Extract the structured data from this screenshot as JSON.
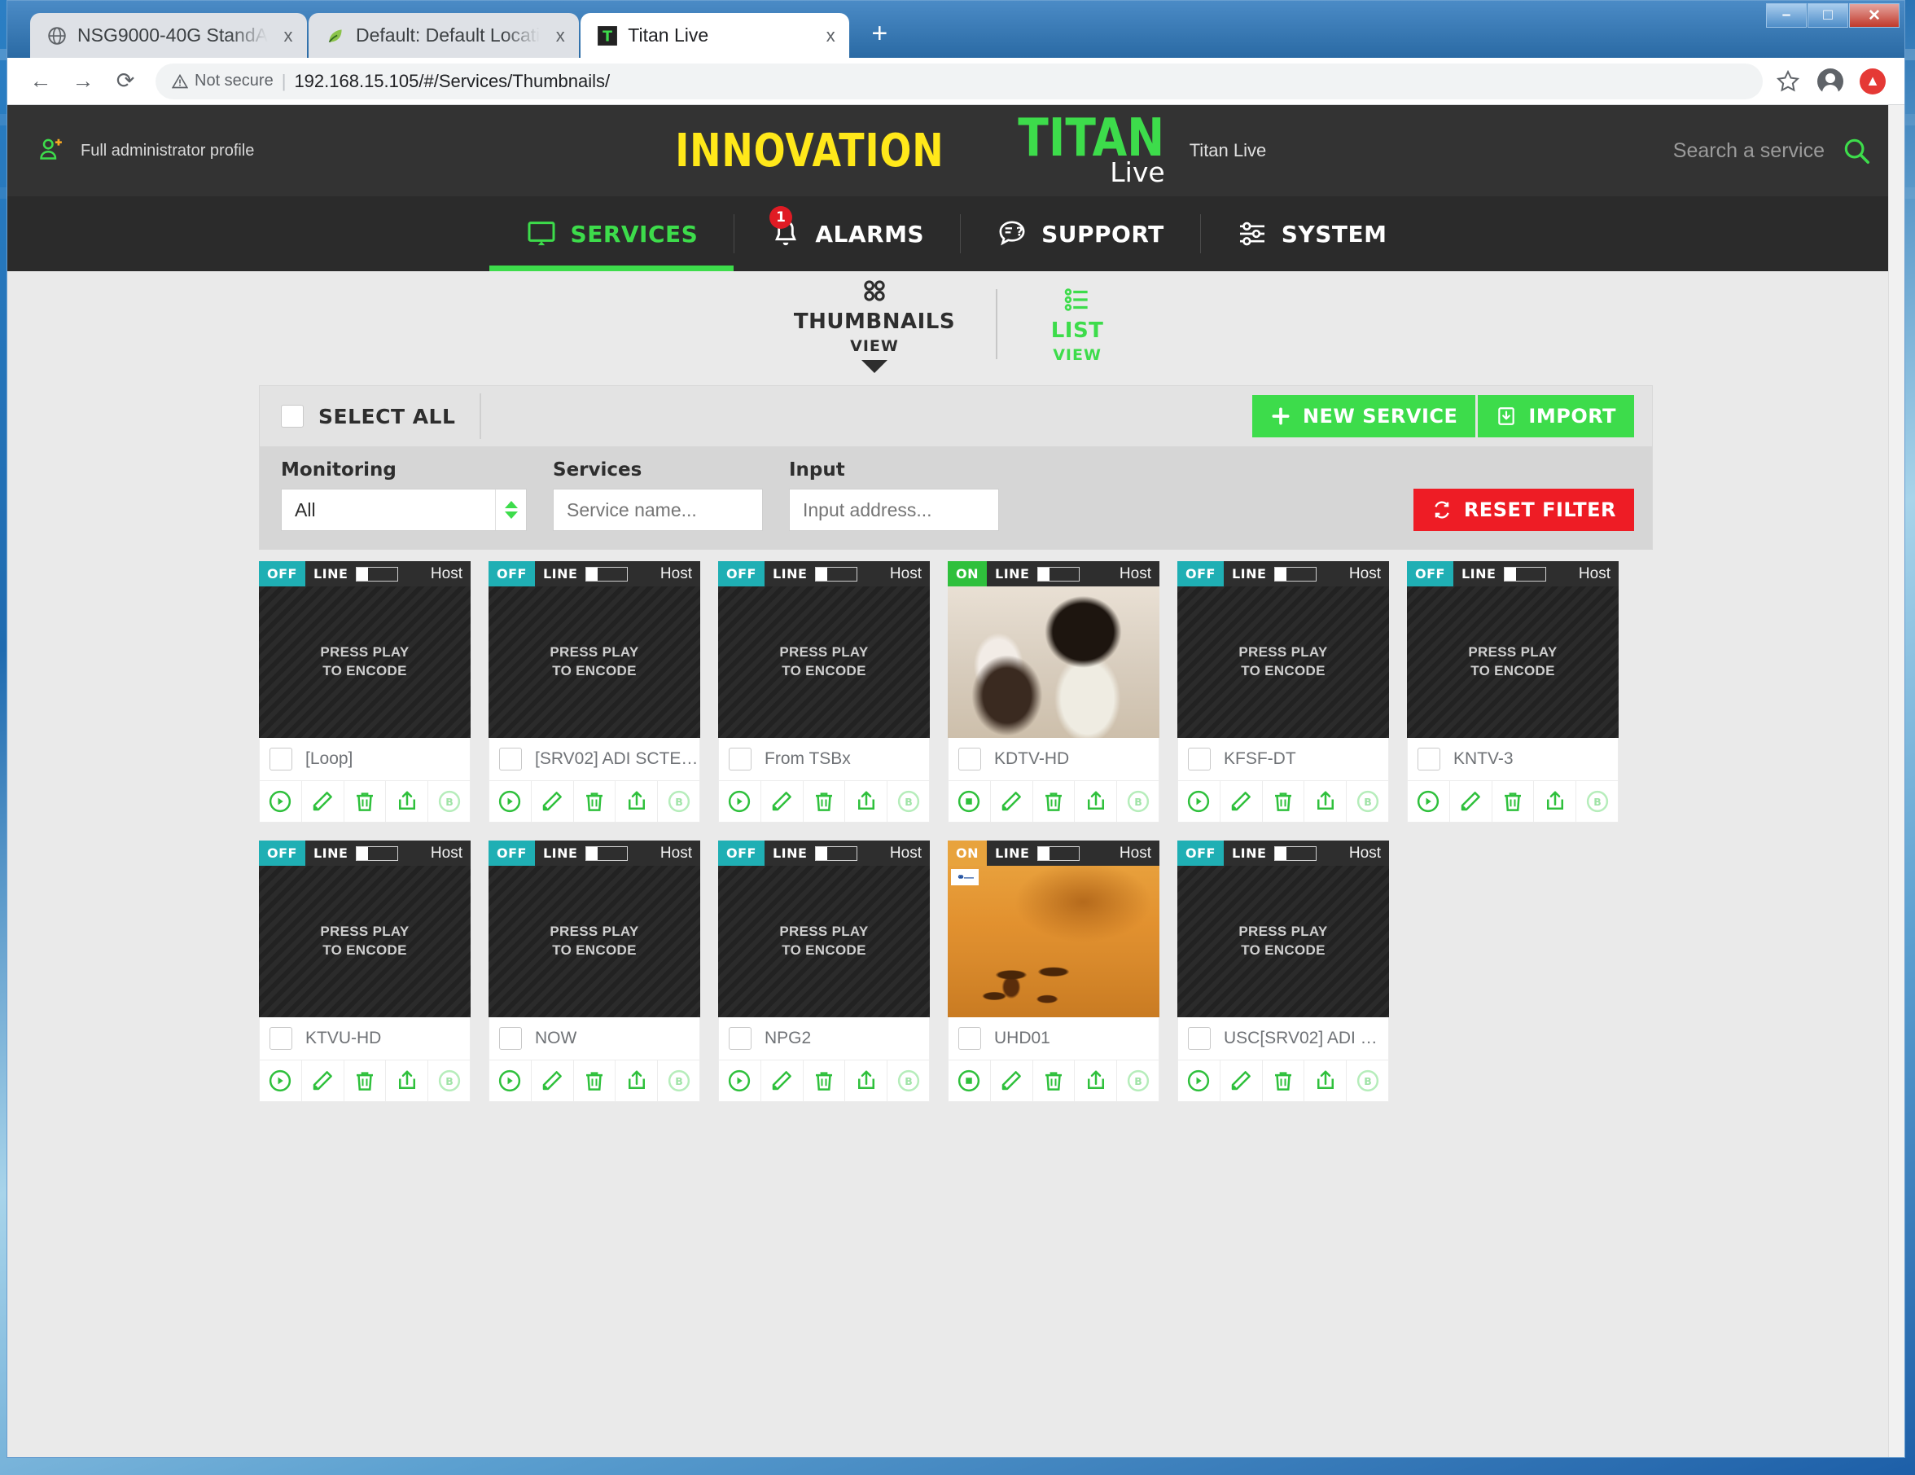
{
  "browser": {
    "tabs": [
      {
        "title": "NSG9000-40G StandA",
        "favicon": "globe-icon",
        "active": false
      },
      {
        "title": "Default: Default Locati",
        "favicon": "leaf-icon",
        "active": false
      },
      {
        "title": "Titan Live",
        "favicon": "titan-icon",
        "active": true
      }
    ],
    "new_tab_label": "+",
    "close_label": "x",
    "nav": {
      "back": "←",
      "forward": "→",
      "reload": "⟳"
    },
    "security_label": "Not secure",
    "separator": "|",
    "url": "192.168.15.105/#/Services/Thumbnails/",
    "window_controls": {
      "minimize": "–",
      "maximize": "□",
      "close": "✕"
    }
  },
  "header": {
    "profile_label": "Full administrator profile",
    "profile_icon": "user-add-icon",
    "brand_innovation": "INNOVATION",
    "brand_titan": "TITAN",
    "brand_live": "Live",
    "product_name": "Titan Live",
    "search_placeholder": "Search a service",
    "search_icon": "search-icon",
    "colors": {
      "yellow": "#ffe81a",
      "green": "#3ddc4b",
      "bar": "#333333"
    }
  },
  "nav": {
    "items": [
      {
        "label": "SERVICES",
        "icon": "monitor-icon",
        "active": true,
        "badge": null
      },
      {
        "label": "ALARMS",
        "icon": "bell-icon",
        "active": false,
        "badge": "1"
      },
      {
        "label": "SUPPORT",
        "icon": "help-bubble-icon",
        "active": false,
        "badge": null
      },
      {
        "label": "SYSTEM",
        "icon": "sliders-icon",
        "active": false,
        "badge": null
      }
    ]
  },
  "view_switcher": {
    "options": [
      {
        "name": "THUMBNAILS",
        "sub": "VIEW",
        "icon": "grid-dots-icon",
        "active": true
      },
      {
        "name": "LIST",
        "sub": "VIEW",
        "icon": "list-icon",
        "active": false
      }
    ]
  },
  "toolbar": {
    "select_all_label": "SELECT ALL",
    "new_service_label": "NEW SERVICE",
    "new_service_icon": "plus-icon",
    "import_label": "IMPORT",
    "import_icon": "import-icon",
    "reset_filter_label": "RESET FILTER",
    "reset_filter_icon": "refresh-icon"
  },
  "filters": {
    "monitoring_label": "Monitoring",
    "monitoring_value": "All",
    "services_label": "Services",
    "services_placeholder": "Service name...",
    "input_label": "Input",
    "input_placeholder": "Input address..."
  },
  "thumbnail_placeholder": "PRESS PLAY\nTO ENCODE",
  "thumbnail_placeholder_line1": "PRESS PLAY",
  "thumbnail_placeholder_line2": "TO ENCODE",
  "card_labels": {
    "line": "LINE",
    "host": "Host",
    "status_off": "OFF",
    "status_on": "ON",
    "biss_label": "B"
  },
  "services": [
    {
      "name": "[Loop]",
      "status": "OFF",
      "status_color": "#1fafb4",
      "line": "LINE",
      "host": "Host",
      "thumb": "placeholder",
      "play_state": "play",
      "key_badge": false
    },
    {
      "name": "[SRV02] ADI SCTE…",
      "status": "OFF",
      "status_color": "#1fafb4",
      "line": "LINE",
      "host": "Host",
      "thumb": "placeholder",
      "play_state": "play",
      "key_badge": false
    },
    {
      "name": "From TSBx",
      "status": "OFF",
      "status_color": "#1fafb4",
      "line": "LINE",
      "host": "Host",
      "thumb": "placeholder",
      "play_state": "play",
      "key_badge": false
    },
    {
      "name": "KDTV-HD",
      "status": "ON",
      "status_color": "#2fc03c",
      "line": "LINE",
      "host": "Host",
      "thumb": "live-people",
      "play_state": "stop",
      "key_badge": false
    },
    {
      "name": "KFSF-DT",
      "status": "OFF",
      "status_color": "#1fafb4",
      "line": "LINE",
      "host": "Host",
      "thumb": "placeholder",
      "play_state": "play",
      "key_badge": false
    },
    {
      "name": "KNTV-3",
      "status": "OFF",
      "status_color": "#1fafb4",
      "line": "LINE",
      "host": "Host",
      "thumb": "placeholder",
      "play_state": "play",
      "key_badge": false
    },
    {
      "name": "KTVU-HD",
      "status": "OFF",
      "status_color": "#1fafb4",
      "line": "LINE",
      "host": "Host",
      "thumb": "placeholder",
      "play_state": "play",
      "key_badge": false
    },
    {
      "name": "NOW",
      "status": "OFF",
      "status_color": "#1fafb4",
      "line": "LINE",
      "host": "Host",
      "thumb": "placeholder",
      "play_state": "play",
      "key_badge": false
    },
    {
      "name": "NPG2",
      "status": "OFF",
      "status_color": "#1fafb4",
      "line": "LINE",
      "host": "Host",
      "thumb": "placeholder",
      "play_state": "play",
      "key_badge": false
    },
    {
      "name": "UHD01",
      "status": "ON",
      "status_color": "#e8a33d",
      "line": "LINE",
      "host": "Host",
      "thumb": "live-ducks",
      "play_state": "stop",
      "key_badge": true
    },
    {
      "name": "USC[SRV02] ADI …",
      "status": "OFF",
      "status_color": "#1fafb4",
      "line": "LINE",
      "host": "Host",
      "thumb": "placeholder",
      "play_state": "play",
      "key_badge": false
    }
  ],
  "card_action_icons": [
    "play-icon",
    "edit-pencil-icon",
    "delete-trash-icon",
    "export-upload-icon",
    "biss-key-icon"
  ]
}
